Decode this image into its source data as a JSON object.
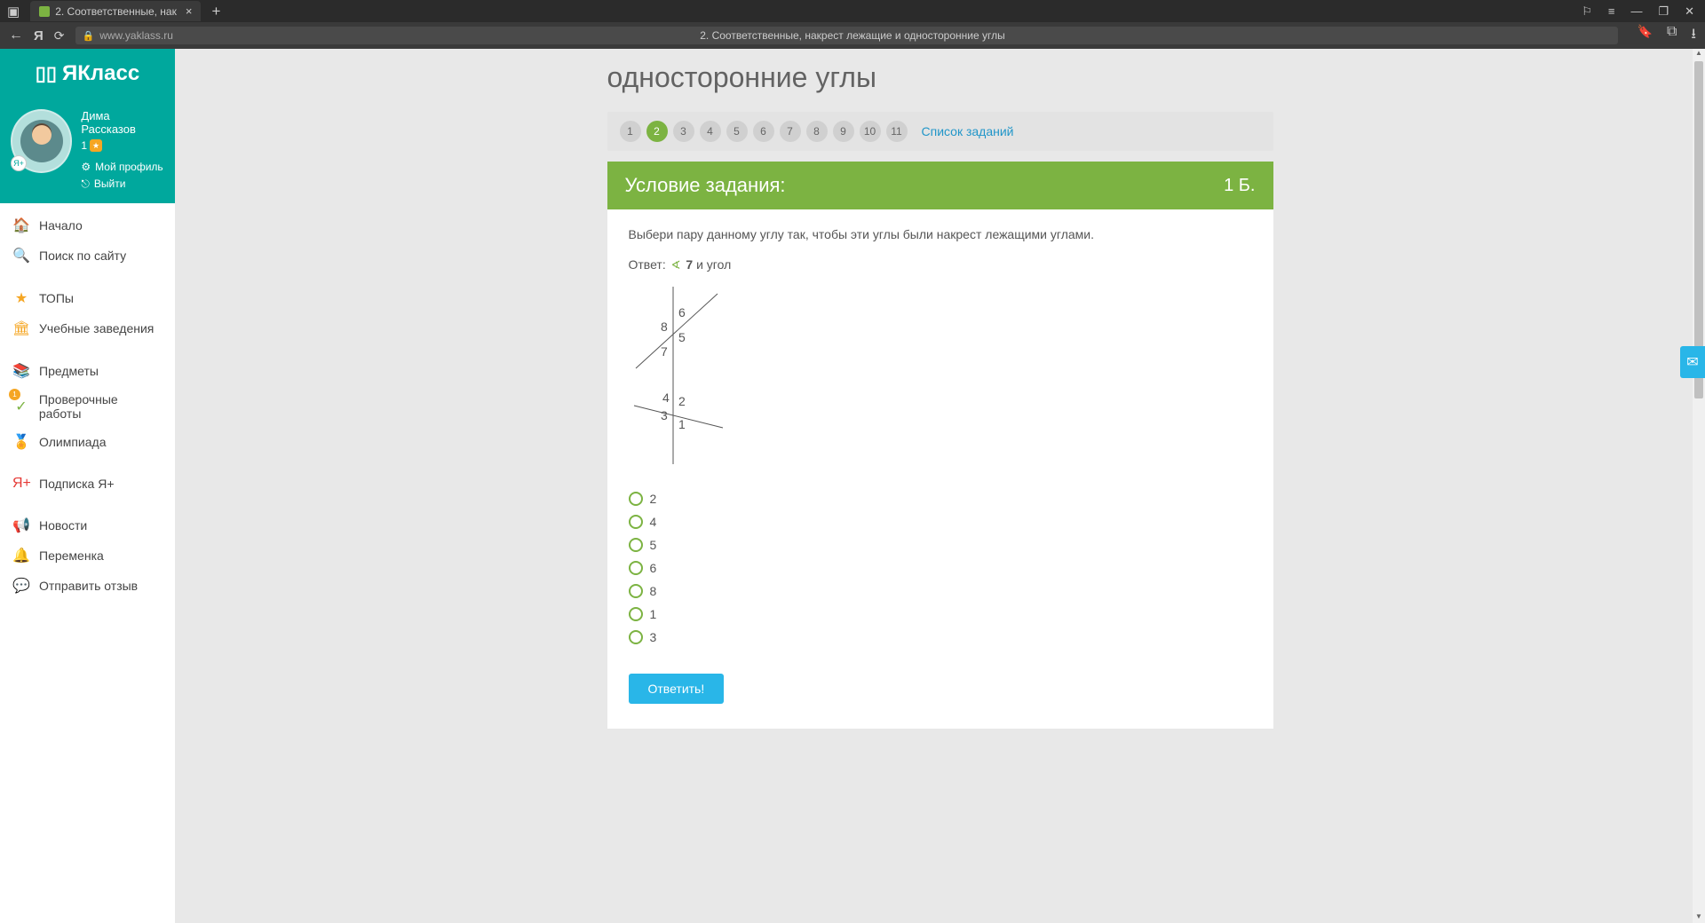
{
  "browser": {
    "tab_title": "2. Соответственные, нак",
    "page_title_center": "2. Соответственные, накрест лежащие и односторонние углы",
    "url": "www.yaklass.ru"
  },
  "logo": "ЯКласс",
  "user": {
    "name": "Дима Рассказов",
    "score": "1",
    "profile_link": "Мой профиль",
    "logout_link": "Выйти"
  },
  "nav": {
    "home": "Начало",
    "search": "Поиск по сайту",
    "tops": "ТОПы",
    "institutions": "Учебные заведения",
    "subjects": "Предметы",
    "tests": "Проверочные работы",
    "olympiad": "Олимпиада",
    "subscription": "Подписка Я+",
    "news": "Новости",
    "break": "Переменка",
    "feedback": "Отправить отзыв"
  },
  "page_heading": "односторонние углы",
  "steps": [
    "1",
    "2",
    "3",
    "4",
    "5",
    "6",
    "7",
    "8",
    "9",
    "10",
    "11"
  ],
  "active_step": 2,
  "task_list_link": "Список заданий",
  "condition": {
    "title": "Условие задания:",
    "points": "1 Б."
  },
  "task": {
    "question": "Выбери пару данному углу так, чтобы эти углы были накрест лежащими углами.",
    "answer_prefix": "Ответ:",
    "given_angle": "7",
    "and_angle_text": "и угол"
  },
  "diagram": {
    "labels": [
      "8",
      "7",
      "6",
      "5",
      "4",
      "3",
      "2",
      "1"
    ]
  },
  "options": [
    "2",
    "4",
    "5",
    "6",
    "8",
    "1",
    "3"
  ],
  "submit": "Ответить!"
}
